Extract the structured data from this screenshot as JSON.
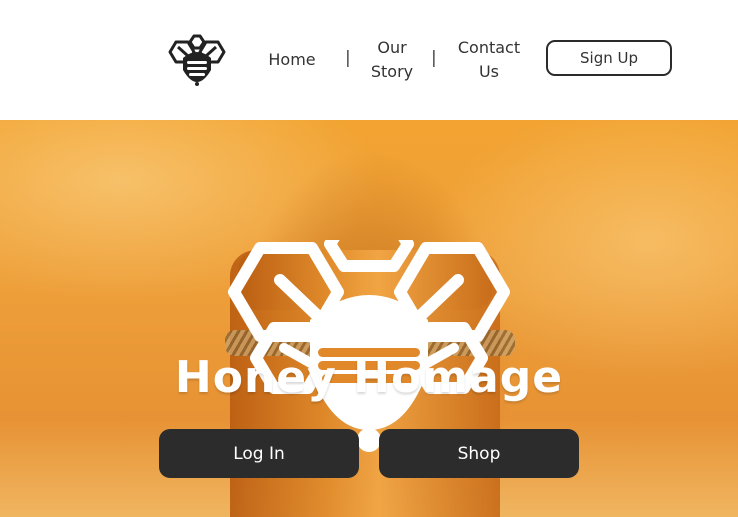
{
  "nav": {
    "logo_icon": "bee-icon",
    "links": [
      {
        "label": "Home"
      },
      {
        "label": "Our Story"
      },
      {
        "label": "Contact Us"
      }
    ],
    "separator": "|",
    "signup_label": "Sign Up"
  },
  "hero": {
    "logo_icon": "bee-honeycomb-icon",
    "brand_title": "Honey Homage",
    "login_label": "Log In",
    "shop_label": "Shop"
  },
  "colors": {
    "dark_button": "#2c2c2c",
    "honey": "#eea03a",
    "text": "#333333"
  }
}
